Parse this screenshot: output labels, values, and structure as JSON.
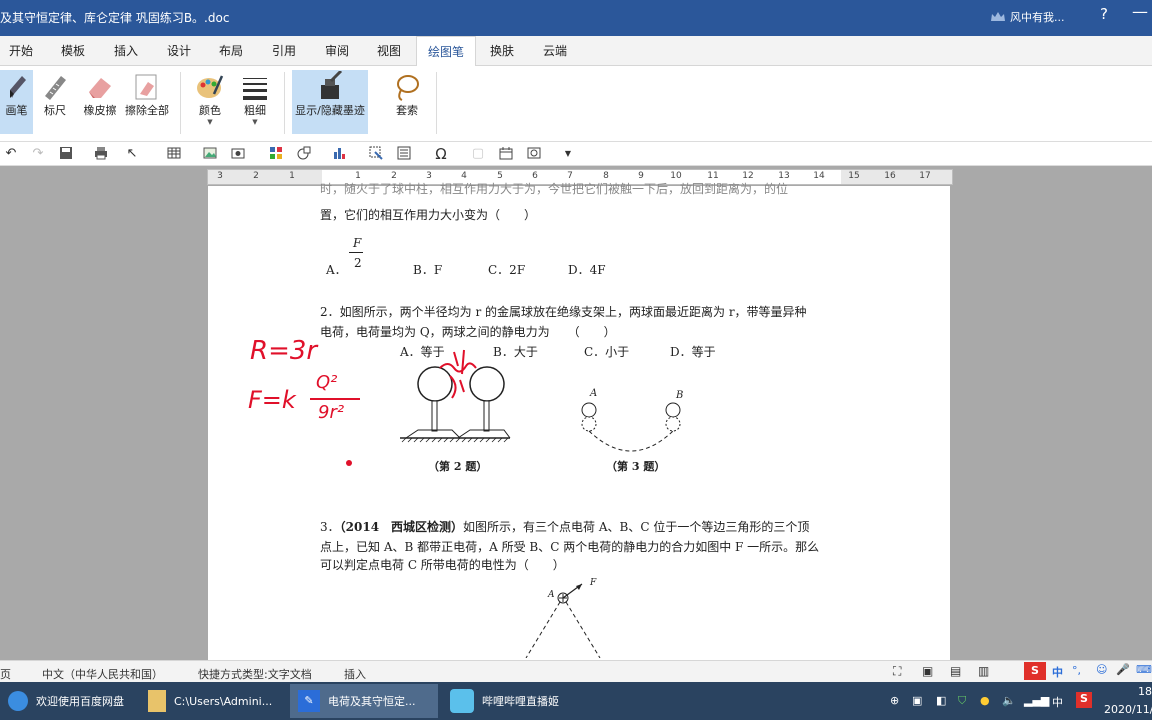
{
  "window": {
    "title": "及其守恒定律、库仑定律 巩固练习B。.doc",
    "user": "风中有我...",
    "help": "?",
    "minimize": "—"
  },
  "tabs": [
    "开始",
    "模板",
    "插入",
    "设计",
    "布局",
    "引用",
    "审阅",
    "视图",
    "绘图笔",
    "换肤",
    "云端"
  ],
  "active_tab": "绘图笔",
  "ribbon": {
    "pen": "画笔",
    "ruler": "标尺",
    "eraser": "橡皮擦",
    "erase_all": "擦除全部",
    "color": "颜色",
    "thickness": "粗细",
    "toggle_ink": "显示/隐藏墨迹",
    "lasso": "套索"
  },
  "ruler_numbers": [
    "3",
    "2",
    "1",
    "1",
    "2",
    "3",
    "4",
    "5",
    "6",
    "7",
    "8",
    "9",
    "10",
    "11",
    "12",
    "13",
    "14",
    "15",
    "16",
    "17"
  ],
  "document": {
    "q1_cut": "时，随火于了球中柱，相互作用力大于为，今世把它们被触一下后，放回到距离为，的位",
    "q1_line": "置，它们的相互作用力大小变为（　　）",
    "q1_frac_num": "F",
    "q1_frac_den": "2",
    "q1_opt_a": "A．",
    "q1_opt_b": "B．F",
    "q1_opt_c": "C．2F",
    "q1_opt_d": "D．4F",
    "q2_line1": "2．如图所示，两个半径均为 r 的金属球放在绝缘支架上，两球面最近距离为 r，带等量异种",
    "q2_line2": "电荷，电荷量均为 Q，两球之间的静电力为　　（　　）",
    "q2_opt_a": "A．等于",
    "q2_opt_b": "B．大于",
    "q2_opt_c": "C．小于",
    "q2_opt_d": "D．等于",
    "fig2_caption": "（第 2 题）",
    "fig3_caption": "（第 3 题）",
    "fig3_label_a": "A",
    "fig3_label_b": "B",
    "q3_num": "3．",
    "q3_source": "（2014　西城区检测）",
    "q3_line1_rest": "如图所示，有三个点电荷 A、B、C 位于一个等边三角形的三个顶",
    "q3_line2": "点上，已知 A、B 都带正电荷，A 所受 B、C 两个电荷的静电力的合力如图中 F 一所示。那么",
    "q3_line3": "可以判定点电荷 C 所带电荷的电性为（　　）",
    "fig4_label_a": "A",
    "fig4_label_f": "F"
  },
  "handwriting": {
    "line1": "R=3r",
    "line2_left": "F=k",
    "line2_num": "Q²",
    "line2_den": "9r²",
    "ink_color": "#e0102a"
  },
  "status": {
    "page": "页",
    "language": "中文（中华人民共和国）",
    "shortcut_type": "快捷方式类型:文字文档",
    "insert_mode": "插入"
  },
  "taskbar": {
    "items": [
      {
        "label": "欢迎使用百度网盘"
      },
      {
        "label": "C:\\Users\\Admini..."
      },
      {
        "label": "电荷及其守恒定..."
      },
      {
        "label": "哔哩哔哩直播姬"
      }
    ],
    "ime": "中",
    "time": "18",
    "date": "2020/11/"
  },
  "colors": {
    "titlebar": "#2b579a",
    "taskbar": "#2a4360",
    "ink": "#e0102a"
  }
}
